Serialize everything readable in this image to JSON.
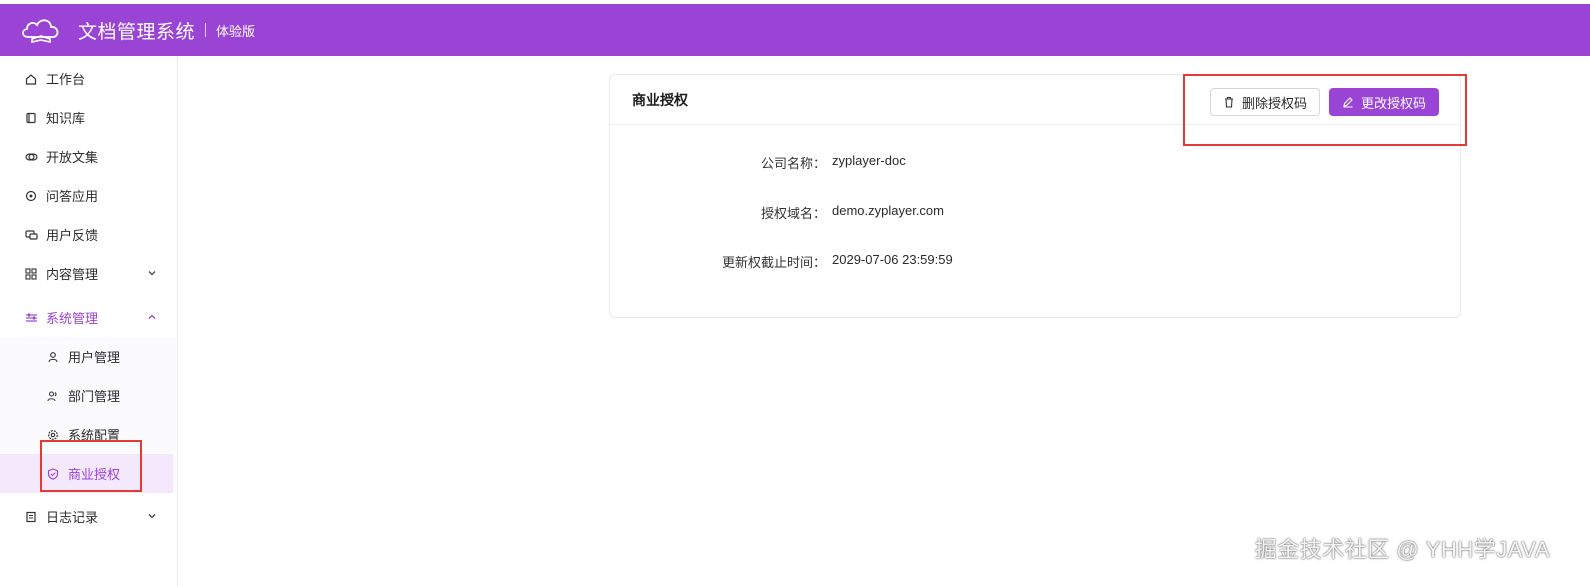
{
  "header": {
    "title": "文档管理系统",
    "edition": "体验版",
    "logo_icon": "cloud-book-logo-icon"
  },
  "sidebar": {
    "items": [
      {
        "label": "工作台",
        "icon": "home-icon"
      },
      {
        "label": "知识库",
        "icon": "book-icon"
      },
      {
        "label": "开放文集",
        "icon": "link-icon"
      },
      {
        "label": "问答应用",
        "icon": "chat-icon"
      },
      {
        "label": "用户反馈",
        "icon": "feedback-icon"
      },
      {
        "label": "内容管理",
        "icon": "grid-icon"
      },
      {
        "label": "系统管理",
        "icon": "sliders-icon"
      },
      {
        "label": "日志记录",
        "icon": "log-icon"
      }
    ],
    "submenu": [
      {
        "label": "用户管理",
        "icon": "user-icon"
      },
      {
        "label": "部门管理",
        "icon": "users-icon"
      },
      {
        "label": "系统配置",
        "icon": "gear-icon"
      },
      {
        "label": "商业授权",
        "icon": "shield-icon"
      }
    ],
    "selected": "商业授权"
  },
  "card": {
    "title": "商业授权",
    "delete_label": "删除授权码",
    "change_label": "更改授权码",
    "fields": [
      {
        "label": "公司名称：",
        "value": "zyplayer-doc"
      },
      {
        "label": "授权域名：",
        "value": "demo.zyplayer.com"
      },
      {
        "label": "更新权截止时间：",
        "value": "2029-07-06 23:59:59"
      }
    ]
  },
  "watermark": "掘金技术社区 @ YHH学JAVA",
  "colors": {
    "accent": "#9a44d6",
    "highlight": "#e53935",
    "selected_bg": "#f3e8fc"
  }
}
